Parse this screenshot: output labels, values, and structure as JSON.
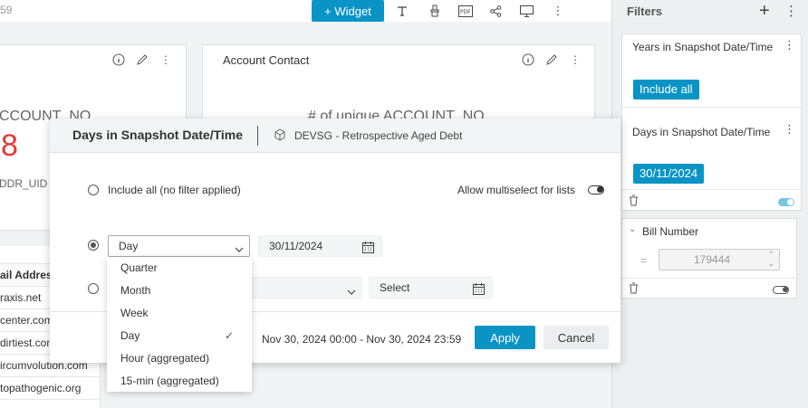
{
  "toolbar": {
    "title_fragment": "59",
    "widget_button": "+ Widget",
    "icons": [
      "text-icon",
      "brush-icon",
      "pdf-icon",
      "share-icon",
      "monitor-icon",
      "more-icon"
    ]
  },
  "cards": {
    "left": {
      "big_text": "CCOUNT_NO",
      "value": "8",
      "sub_text": "DDR_UID"
    },
    "account_contact": {
      "title": "Account Contact",
      "big_text": "# of unique ACCOUNT_NO"
    }
  },
  "table": {
    "header": "ail Address",
    "rows": [
      "raxis.net",
      "center.com",
      "dirtiest.com",
      "ircumvolution.com",
      "topathogenic.org"
    ]
  },
  "filters_panel": {
    "title": "Filters",
    "years_filter": {
      "label": "Years in Snapshot Date/Time",
      "chip": "Include all"
    },
    "days_filter": {
      "label": "Days in Snapshot Date/Time",
      "chip": "30/11/2024"
    },
    "bill_filter": {
      "label": "Bill Number",
      "operator": "=",
      "value": "179444"
    }
  },
  "modal": {
    "title": "Days in Snapshot Date/Time",
    "datasource": "DEVSG - Retrospective Aged Debt",
    "include_all_label": "Include all (no filter applied)",
    "multiselect_label": "Allow multiselect for lists",
    "granularity_selected": "Day",
    "date_value": "30/11/2024",
    "range_placeholder": "Select",
    "range_text": "Nov 30, 2024 00:00 - Nov 30, 2024 23:59",
    "apply_label": "Apply",
    "cancel_label": "Cancel"
  },
  "dropdown": {
    "options": [
      "Quarter",
      "Month",
      "Week",
      "Day",
      "Hour (aggregated)",
      "15-min (aggregated)"
    ],
    "selected": "Day"
  },
  "colors": {
    "accent": "#0a94c6",
    "value_red": "#e53935"
  }
}
